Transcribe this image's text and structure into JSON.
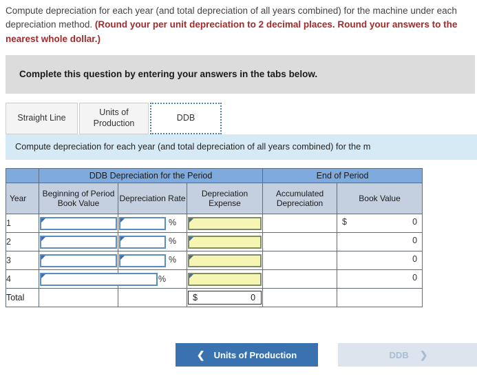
{
  "prompt": {
    "plain": "Compute depreciation for each year (and total depreciation of all years combined) for the machine under each depreciation method. ",
    "red": "(Round your per unit depreciation to 2 decimal places. Round your answers to the nearest whole dollar.)"
  },
  "banner": {
    "text": "Complete this question by entering your answers in the tabs below."
  },
  "tabs": [
    {
      "label": "Straight Line",
      "active": false
    },
    {
      "label": "Units of Production",
      "active": false
    },
    {
      "label": "DDB",
      "active": true
    }
  ],
  "instruction": {
    "text": "Compute depreciation for each year (and total depreciation of all years combined) for the m"
  },
  "table": {
    "group_headers": [
      {
        "label": "",
        "span": 1
      },
      {
        "label": "DDB Depreciation for the Period",
        "span": 3
      },
      {
        "label": "End of Period",
        "span": 2
      }
    ],
    "columns": [
      "Year",
      "Beginning of Period Book Value",
      "Depreciation Rate",
      "Depreciation Expense",
      "Accumulated Depreciation",
      "Book Value"
    ],
    "rows": [
      {
        "year": "1",
        "beginning": "",
        "rate": "",
        "rate_suffix": "%",
        "expense": "",
        "accumulated": "",
        "book_value_symbol": "$",
        "book_value": "0"
      },
      {
        "year": "2",
        "beginning": "",
        "rate": "",
        "rate_suffix": "%",
        "expense": "",
        "accumulated": "",
        "book_value_symbol": "",
        "book_value": "0"
      },
      {
        "year": "3",
        "beginning": "",
        "rate": "",
        "rate_suffix": "%",
        "expense": "",
        "accumulated": "",
        "book_value_symbol": "",
        "book_value": "0"
      },
      {
        "year": "4",
        "beginning": "",
        "rate": "",
        "rate_suffix": "%",
        "expense": "",
        "accumulated": "",
        "book_value_symbol": "",
        "book_value": "0"
      }
    ],
    "total_row": {
      "label": "Total",
      "expense_symbol": "$",
      "expense_value": "0"
    }
  },
  "footer": {
    "prev_label": "Units of Production",
    "prev_icon": "chevron-left",
    "next_label": "DDB",
    "next_icon": "chevron-right"
  },
  "colors": {
    "header_blue": "#7eaade",
    "subheader_blue_gray": "#c4cfe0",
    "instruction_blue": "#d6eaf6",
    "banner_gray": "#dcdcdc",
    "input_border": "#5b8cc0",
    "input_yellow": "#f6f5b4",
    "button_primary": "#3a72b0",
    "button_disabled": "#dde4ed",
    "red_bold": "#a32a2a"
  }
}
